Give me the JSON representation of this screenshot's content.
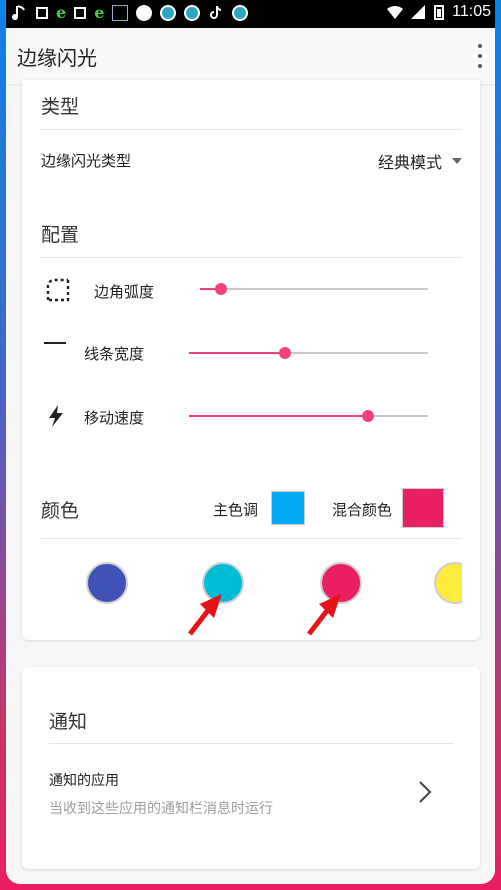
{
  "app": {
    "title": "边缘闪光"
  },
  "status_bar": {
    "time": "11:05"
  },
  "type_section": {
    "title": "类型",
    "mode_label": "边缘闪光类型",
    "mode_value": "经典模式"
  },
  "config_section": {
    "title": "配置",
    "sliders": [
      {
        "label": "边角弧度",
        "value_fraction": 0.09
      },
      {
        "label": "线条宽度",
        "value_fraction": 0.4
      },
      {
        "label": "移动速度",
        "value_fraction": 0.75
      }
    ]
  },
  "color_section": {
    "title": "颜色",
    "primary_label": "主色调",
    "primary_color": "#03a9f4",
    "mix_label": "混合颜色",
    "mix_color": "#e91e63",
    "palette": [
      "#3f51b5",
      "#00bcd4",
      "#e91e63",
      "#ffeb3b"
    ]
  },
  "notify_section": {
    "title": "通知",
    "item_title": "通知的应用",
    "item_subtitle": "当收到这些应用的通知栏消息时运行"
  },
  "accent_color": "#f0437a"
}
